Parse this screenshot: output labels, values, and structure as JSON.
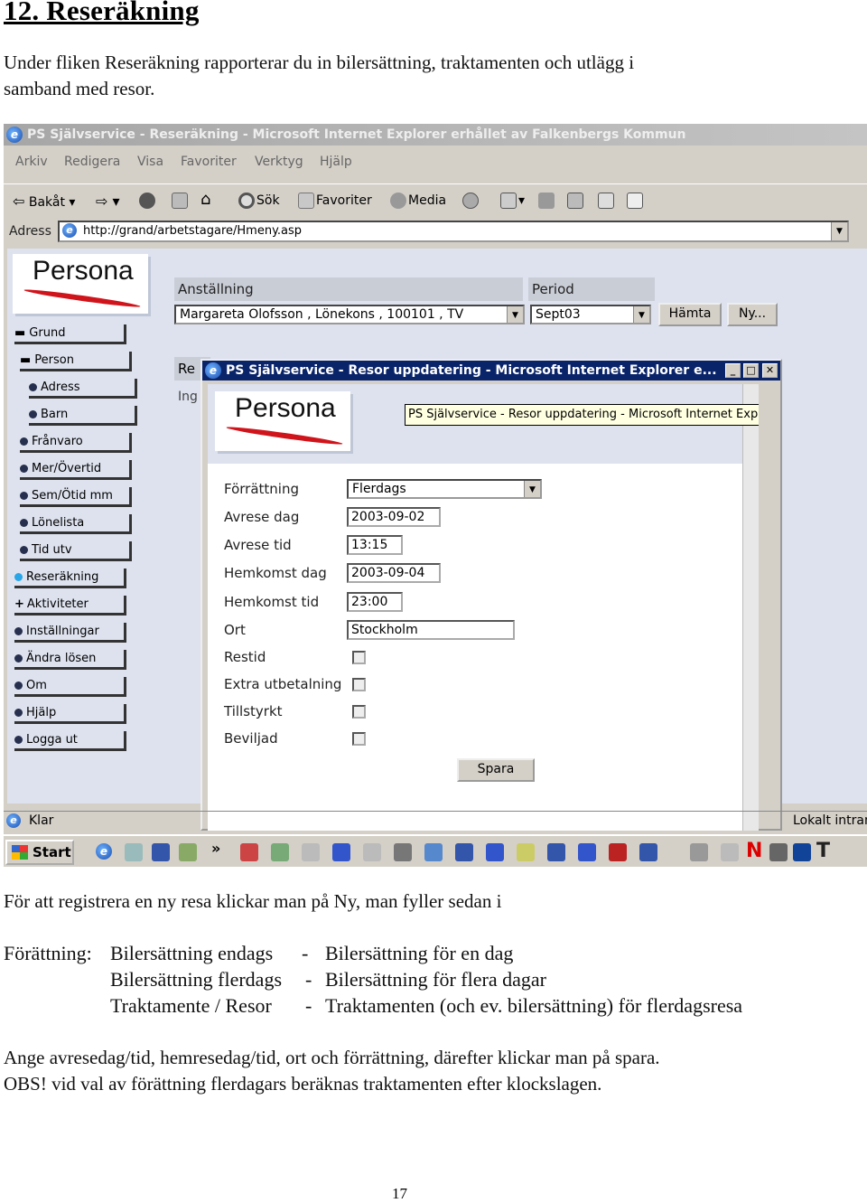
{
  "document": {
    "heading": "12. Reseräkning",
    "intro_line1": "Under fliken Reseräkning rapporterar du in bilersättning, traktamenten och utlägg i",
    "intro_line2": "samband med resor.",
    "after_line": "För att registrera en ny resa klickar man på Ny, man fyller sedan i",
    "options_label": "Förättning:",
    "options": [
      {
        "name": "Bilersättning endags",
        "sep": "-",
        "desc": "Bilersättning för en dag"
      },
      {
        "name": "Bilersättning flerdags",
        "sep": "-",
        "desc": "Bilersättning för flera dagar"
      },
      {
        "name": "Traktamente / Resor",
        "sep": "-",
        "desc": "Traktamenten (och ev. bilersättning) för flerdagsresa"
      }
    ],
    "instr_line1": "Ange avresedag/tid, hemresedag/tid, ort och förrättning, därefter klickar man på spara.",
    "instr_line2": "OBS! vid val av förättning flerdagars beräknas traktamenten efter klockslagen.",
    "page_number": "17"
  },
  "browser": {
    "title": "PS Självservice - Reseräkning - Microsoft Internet Explorer erhållet av Falkenbergs Kommun",
    "menu": [
      "Arkiv",
      "Redigera",
      "Visa",
      "Favoriter",
      "Verktyg",
      "Hjälp"
    ],
    "toolbar": {
      "back": "Bakåt",
      "search": "Sök",
      "favorites": "Favoriter",
      "media": "Media"
    },
    "address_label": "Adress",
    "address_url": "http://grand/arbetstagare/Hmeny.asp",
    "status": "Klar",
    "status_right": "Lokalt intran"
  },
  "app": {
    "logo": "Persona",
    "nav": [
      {
        "label": "Grund",
        "marker": "dash"
      },
      {
        "label": "Person",
        "marker": "dash"
      },
      {
        "label": "Adress",
        "marker": "dot"
      },
      {
        "label": "Barn",
        "marker": "dot"
      },
      {
        "label": "Frånvaro",
        "marker": "dot"
      },
      {
        "label": "Mer/Övertid",
        "marker": "dot"
      },
      {
        "label": "Sem/Ötid mm",
        "marker": "dot"
      },
      {
        "label": "Lönelista",
        "marker": "dot"
      },
      {
        "label": "Tid utv",
        "marker": "dot"
      },
      {
        "label": "Reseräkning",
        "marker": "dot-active"
      },
      {
        "label": "Aktiviteter",
        "marker": "plus"
      },
      {
        "label": "Inställningar",
        "marker": "dot"
      },
      {
        "label": "Ändra lösen",
        "marker": "dot"
      },
      {
        "label": "Om",
        "marker": "dot"
      },
      {
        "label": "Hjälp",
        "marker": "dot"
      },
      {
        "label": "Logga ut",
        "marker": "dot"
      }
    ],
    "employment_label": "Anställning",
    "employment_value": "Margareta Olofsson , Lönekons , 100101 , TV",
    "period_label": "Period",
    "period_value": "Sept03",
    "fetch_button": "Hämta",
    "new_button": "Ny...",
    "peek_re": "Re",
    "peek_in": "Ing"
  },
  "popup": {
    "title": "PS Självservice - Resor uppdatering - Microsoft Internet Explorer e...",
    "tooltip": "PS Självservice - Resor uppdatering - Microsoft Internet Explorer erhållet av F",
    "logo": "Persona",
    "fields": {
      "forrattning_label": "Förrättning",
      "forrattning_value": "Flerdags",
      "avrese_dag_label": "Avrese dag",
      "avrese_dag_value": "2003-09-02",
      "avrese_tid_label": "Avrese tid",
      "avrese_tid_value": "13:15",
      "hemkomst_dag_label": "Hemkomst dag",
      "hemkomst_dag_value": "2003-09-04",
      "hemkomst_tid_label": "Hemkomst tid",
      "hemkomst_tid_value": "23:00",
      "ort_label": "Ort",
      "ort_value": "Stockholm",
      "restid_label": "Restid",
      "extra_label": "Extra utbetalning",
      "tillstyrkt_label": "Tillstyrkt",
      "beviljad_label": "Beviljad"
    },
    "save_button": "Spara"
  },
  "taskbar": {
    "start": "Start",
    "chevron": "»"
  }
}
